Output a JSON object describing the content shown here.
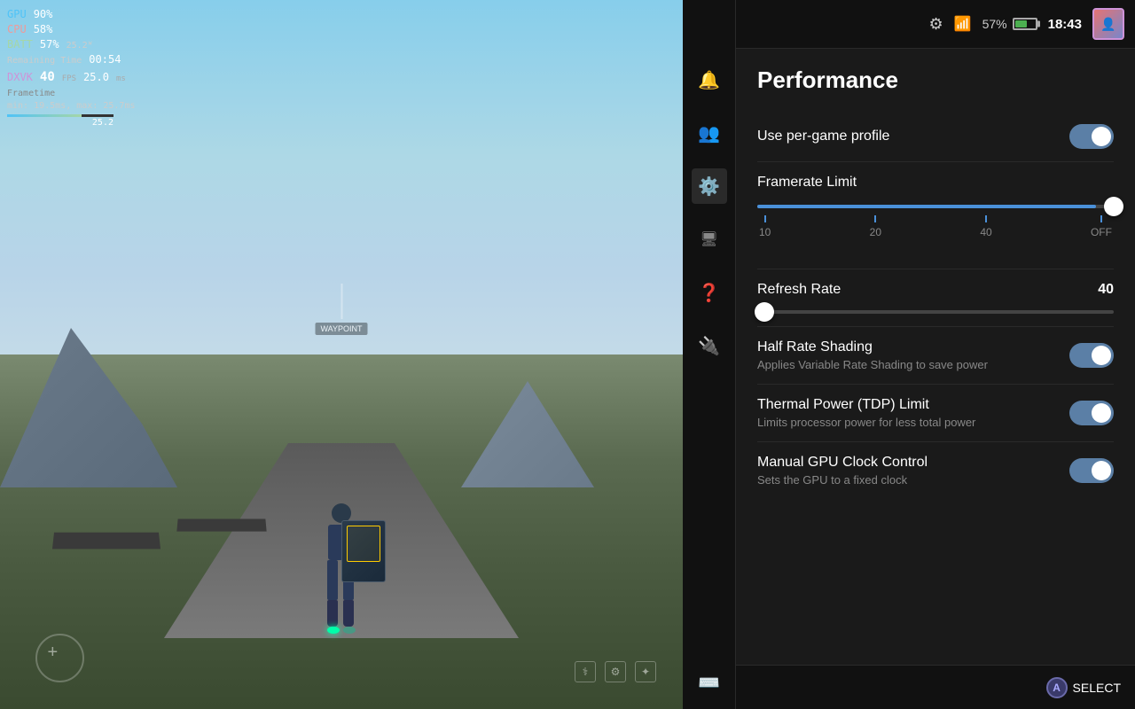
{
  "game_viewport": {
    "hud": {
      "gpu_label": "GPU",
      "gpu_value": "90%",
      "cpu_label": "CPU",
      "cpu_value": "58%",
      "batt_label": "BATT",
      "batt_value": "57%",
      "batt_power": "25.2ᵂ",
      "batt_time": "00:54",
      "dxvk_label": "DXVK",
      "dxvk_fps": "40",
      "dxvk_fps_unit": "FPS",
      "dxvk_ms": "25.0",
      "dxvk_ms_unit": "ms",
      "frametime_label": "Frametime",
      "frametime_detail": "min: 19.5ms, max: 25.7ms",
      "frametime_val": "25.2"
    }
  },
  "top_bar": {
    "battery_pct": "57%",
    "time": "18:43"
  },
  "sidebar": {
    "items": [
      {
        "id": "notifications",
        "icon": "🔔"
      },
      {
        "id": "users",
        "icon": "👥"
      },
      {
        "id": "settings",
        "icon": "⚙️"
      },
      {
        "id": "display",
        "icon": "🖥"
      },
      {
        "id": "help",
        "icon": "❓"
      },
      {
        "id": "power",
        "icon": "🔌"
      },
      {
        "id": "keyboard",
        "icon": "⌨️"
      }
    ]
  },
  "performance_panel": {
    "title": "Performance",
    "settings": [
      {
        "id": "per_game_profile",
        "label": "Use per-game profile",
        "sublabel": "",
        "toggle": true,
        "toggle_state": "on"
      }
    ],
    "framerate_limit": {
      "label": "Framerate Limit",
      "markers": [
        {
          "label": "10",
          "position": 0
        },
        {
          "label": "20",
          "position": 33
        },
        {
          "label": "40",
          "position": 66
        },
        {
          "label": "OFF",
          "position": 100
        }
      ],
      "slider_fill_pct": 95
    },
    "refresh_rate": {
      "label": "Refresh Rate",
      "value": "40",
      "slider_position_pct": 2
    },
    "half_rate_shading": {
      "label": "Half Rate Shading",
      "sublabel": "Applies Variable Rate Shading to save power",
      "toggle_state": "on"
    },
    "thermal_power": {
      "label": "Thermal Power (TDP) Limit",
      "sublabel": "Limits processor power for less total power",
      "toggle_state": "on"
    },
    "manual_gpu": {
      "label": "Manual GPU Clock Control",
      "sublabel": "Sets the GPU to a fixed clock",
      "toggle_state": "on"
    }
  },
  "bottom_bar": {
    "a_button_label": "A",
    "select_label": "SELECT"
  }
}
